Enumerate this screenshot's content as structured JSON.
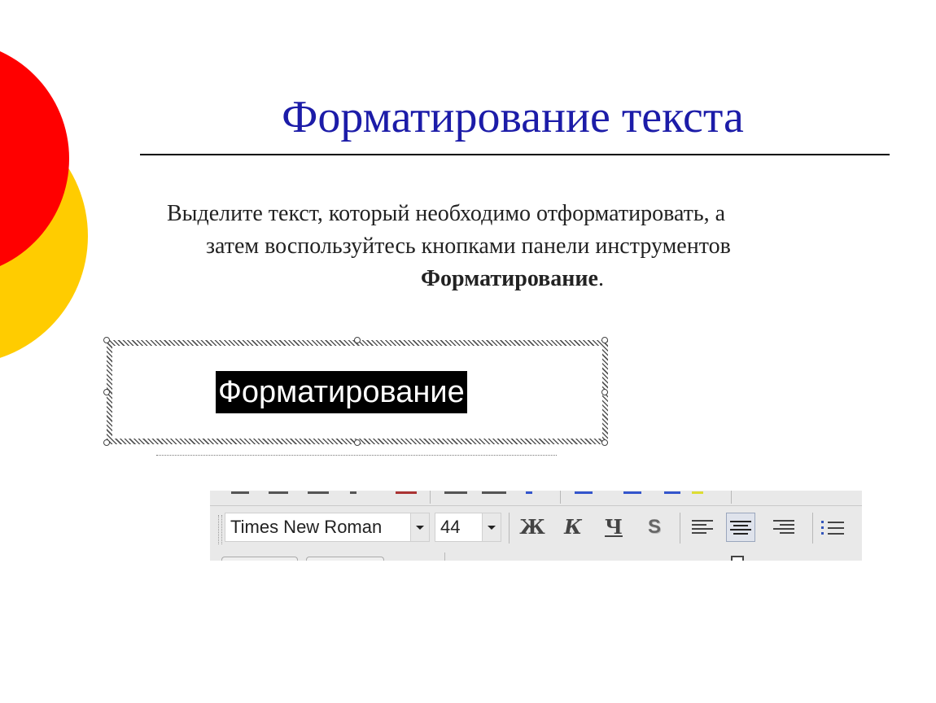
{
  "colors": {
    "title": "#1c1ca8",
    "circle_red": "#ff0000",
    "circle_yellow": "#ffcc00",
    "selection_bg": "#000000",
    "selection_fg": "#ffffff",
    "toolbar_bg": "#e9e9e9"
  },
  "slide": {
    "title": "Форматирование текста",
    "body": {
      "line1": "Выделите текст, который необходимо отформатировать, а",
      "line2": "затем воспользуйтесь кнопками панели инструментов",
      "emphasis": "Форматирование",
      "end": "."
    }
  },
  "textbox": {
    "selected_text": "Форматирование"
  },
  "toolbar": {
    "font_name": "Times New Roman",
    "font_size": "44",
    "bold_label": "Ж",
    "italic_label": "К",
    "underline_label": "Ч",
    "shadow_label": "S",
    "buttons": [
      {
        "name": "bold-button",
        "icon": "bold-icon"
      },
      {
        "name": "italic-button",
        "icon": "italic-icon"
      },
      {
        "name": "underline-button",
        "icon": "underline-icon"
      },
      {
        "name": "shadow-button",
        "icon": "text-shadow-icon"
      },
      {
        "name": "align-left-button",
        "icon": "align-left-icon"
      },
      {
        "name": "align-center-button",
        "icon": "align-center-icon",
        "active": true
      },
      {
        "name": "align-right-button",
        "icon": "align-right-icon"
      },
      {
        "name": "numbering-button",
        "icon": "numbered-list-icon"
      }
    ]
  }
}
